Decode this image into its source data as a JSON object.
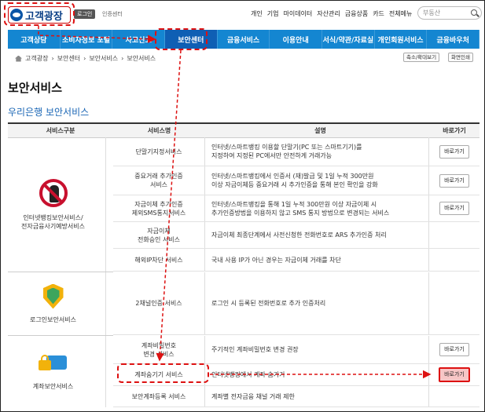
{
  "header": {
    "logo_text": "고객광장",
    "login_label": "로그인",
    "cert_label": "인증센터",
    "top_menu": [
      "개인",
      "기업",
      "마이데이터",
      "자산관리",
      "금융상품",
      "카드",
      "전체메뉴"
    ],
    "search_placeholder": "부동산"
  },
  "nav": {
    "items": [
      "고객상담",
      "소비자정보 포털",
      "사고신고",
      "보안센터",
      "금융서비스",
      "이용안내",
      "서식/약관/자료실",
      "개인회원서비스",
      "금융바우처"
    ],
    "active_index": 3
  },
  "breadcrumb": [
    "고객광장",
    "보안센터",
    "보안서비스",
    "보안서비스"
  ],
  "tools": {
    "zoom_label": "축소/확대보기",
    "print_label": "화면인쇄"
  },
  "page_title": "보안서비스",
  "section_title": "우리은행 보안서비스",
  "table": {
    "headers": [
      "서비스구분",
      "서비스명",
      "설명",
      "바로가기"
    ],
    "go_label": "바로가기",
    "groups": [
      {
        "name": "인터넷뱅킹보안서비스/\n전자금융사기예방서비스",
        "icon": "no-phishing-icon"
      },
      {
        "name": "로그인보안서비스",
        "icon": "shield-icon"
      },
      {
        "name": "계좌보안서비스",
        "icon": "lock-card-icon"
      }
    ],
    "rows": [
      {
        "name": "단말기지정서비스",
        "desc": "인터넷/스마트뱅킹 이용할 단말기(PC 또는 스마트기기)를\n지정하여 지정된 PC에서만 안전하게 거래가능",
        "go": true
      },
      {
        "name": "중요거래 추가인증\n서비스",
        "desc": "인터넷/스마트뱅킹에서 인증서 (재)발급 및 1일 누적 300만원\n이상 자금이체등 중요거래 시 추가인증을 통해 본인 확인을 강화",
        "go": true
      },
      {
        "name": "자금이체 추가인증\n제외SMS통지서비스",
        "desc": "인터넷/스마트뱅킹을 통해 1일 누적 300만원 이상 자금이체 시\n추가인증방법을 이용하지 않고 SMS 통지 방법으로 변경되는 서비스",
        "go": true
      },
      {
        "name": "자금이체\n전화승인 서비스",
        "desc": "자금이체 최종단계에서 사전신청한 전화번호로 ARS 추가인증 처리",
        "go": false
      },
      {
        "name": "해외IP차단 서비스",
        "desc": "국내 사용 IP가 아닌 경우는 자금이체 거래를 차단",
        "go": false
      },
      {
        "name": "2채널인증 서비스",
        "desc": "로그인 시 등록된 전화번호로 추가 인증처리",
        "go": false
      },
      {
        "name": "계좌비밀번호\n변경 서비스",
        "desc": "주기적인 계좌비밀번호 변경 권장",
        "go": true
      },
      {
        "name": "계좌숨기기 서비스",
        "desc": "인터넷뱅킹에서 계좌 숨기기",
        "go": true
      },
      {
        "name": "보안계좌등록 서비스",
        "desc": "계좌별 전자금융 채널 거래 제한",
        "go": false
      }
    ]
  }
}
